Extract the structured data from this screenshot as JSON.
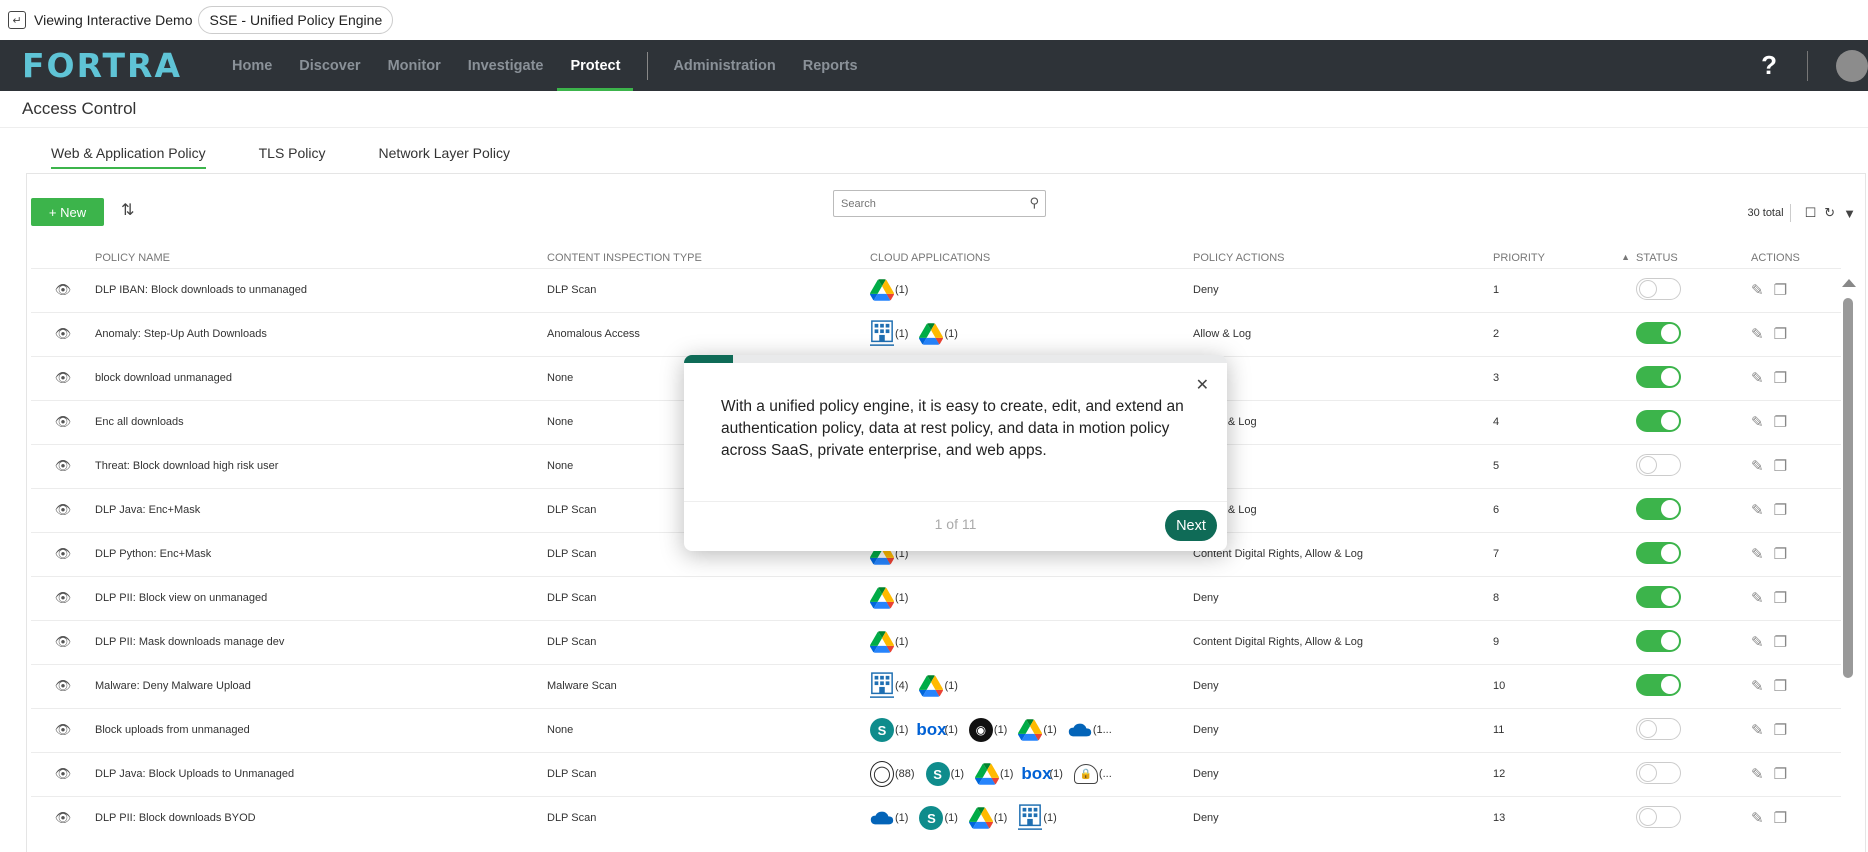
{
  "demo": {
    "label": "Viewing Interactive Demo",
    "title": "SSE - Unified Policy Engine"
  },
  "nav": {
    "logo": "FORTRA",
    "items": [
      "Home",
      "Discover",
      "Monitor",
      "Investigate",
      "Protect"
    ],
    "items_right": [
      "Administration",
      "Reports"
    ],
    "active": "Protect",
    "help": "?"
  },
  "page": {
    "title": "Access Control"
  },
  "tabs": [
    "Web & Application Policy",
    "TLS Policy",
    "Network Layer Policy"
  ],
  "toolbar": {
    "new_label": "+ New",
    "search_placeholder": "Search",
    "total": "30 total"
  },
  "columns": [
    "POLICY NAME",
    "CONTENT INSPECTION TYPE",
    "CLOUD APPLICATIONS",
    "POLICY ACTIONS",
    "PRIORITY",
    "STATUS",
    "ACTIONS"
  ],
  "rows": [
    {
      "name": "DLP IBAN: Block downloads to unmanaged",
      "inspection": "DLP Scan",
      "apps": [
        [
          "gdrive",
          "(1)"
        ]
      ],
      "action": "Deny",
      "priority": "1",
      "status": false
    },
    {
      "name": "Anomaly: Step-Up Auth Downloads",
      "inspection": "Anomalous Access",
      "apps": [
        [
          "bldg",
          "(1)"
        ],
        [
          "gdrive",
          "(1)"
        ]
      ],
      "action": "Allow & Log",
      "priority": "2",
      "status": true
    },
    {
      "name": "block download unmanaged",
      "inspection": "None",
      "apps": [],
      "action": "",
      "priority": "3",
      "status": true
    },
    {
      "name": "Enc all downloads",
      "inspection": "None",
      "apps": [],
      "action": ", Allow & Log",
      "priority": "4",
      "status": true
    },
    {
      "name": "Threat: Block download high risk user",
      "inspection": "None",
      "apps": [],
      "action": "",
      "priority": "5",
      "status": false
    },
    {
      "name": "DLP Java: Enc+Mask",
      "inspection": "DLP Scan",
      "apps": [],
      "action": ", Allow & Log",
      "priority": "6",
      "status": true
    },
    {
      "name": "DLP Python: Enc+Mask",
      "inspection": "DLP Scan",
      "apps": [
        [
          "gdrive",
          "(1)"
        ]
      ],
      "action": "Content Digital Rights, Allow & Log",
      "priority": "7",
      "status": true
    },
    {
      "name": "DLP PII: Block view on unmanaged",
      "inspection": "DLP Scan",
      "apps": [
        [
          "gdrive",
          "(1)"
        ]
      ],
      "action": "Deny",
      "priority": "8",
      "status": true
    },
    {
      "name": "DLP PII: Mask downloads manage dev",
      "inspection": "DLP Scan",
      "apps": [
        [
          "gdrive",
          "(1)"
        ]
      ],
      "action": "Content Digital Rights, Allow & Log",
      "priority": "9",
      "status": true
    },
    {
      "name": "Malware: Deny Malware Upload",
      "inspection": "Malware Scan",
      "apps": [
        [
          "bldg",
          "(4)"
        ],
        [
          "gdrive",
          "(1)"
        ]
      ],
      "action": "Deny",
      "priority": "10",
      "status": true
    },
    {
      "name": "Block uploads from unmanaged",
      "inspection": "None",
      "apps": [
        [
          "sp",
          "(1)"
        ],
        [
          "box",
          "(1)"
        ],
        [
          "gh",
          "(1)"
        ],
        [
          "gdrive",
          "(1)"
        ],
        [
          "onedrive",
          "(1..."
        ]
      ],
      "action": "Deny",
      "priority": "11",
      "status": false
    },
    {
      "name": "DLP Java: Block Uploads to Unmanaged",
      "inspection": "DLP Scan",
      "apps": [
        [
          "globe",
          "(88)"
        ],
        [
          "sp",
          "(1)"
        ],
        [
          "gdrive",
          "(1)"
        ],
        [
          "box",
          "(1)"
        ],
        [
          "cloudlock",
          "(..."
        ]
      ],
      "action": "Deny",
      "priority": "12",
      "status": false
    },
    {
      "name": "DLP PII: Block downloads BYOD",
      "inspection": "DLP Scan",
      "apps": [
        [
          "onedrive",
          "(1)"
        ],
        [
          "sp",
          "(1)"
        ],
        [
          "gdrive",
          "(1)"
        ],
        [
          "bldg",
          "(1)"
        ]
      ],
      "action": "Deny",
      "priority": "13",
      "status": false
    }
  ],
  "tour": {
    "message": "With a unified policy engine, it is easy to create, edit, and extend an authentication policy, data at rest policy, and data in motion policy across SaaS, private enterprise, and web apps.",
    "step": "1 of 11",
    "progress": 0.0909,
    "next_label": "Next"
  }
}
